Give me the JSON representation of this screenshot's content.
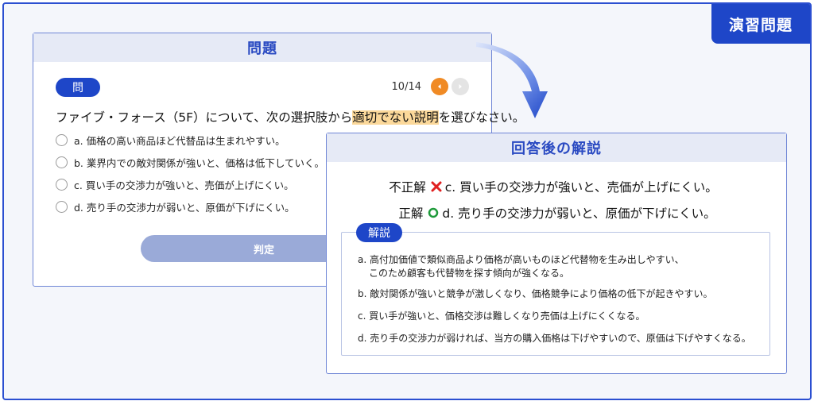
{
  "tag": "演習問題",
  "question_card": {
    "title": "問題",
    "badge": "問",
    "page_counter": "10/14",
    "question_before": "ファイブ・フォース（5F）について、次の選択肢から",
    "question_highlight": "適切でない説明",
    "question_after": "を選びなさい。",
    "options": [
      "a. 価格の高い商品ほど代替品は生まれやすい。",
      "b. 業界内での敵対関係が強いと、価格は低下していく。",
      "c. 買い手の交渉力が強いと、売価が上げにくい。",
      "d. 売り手の交渉力が弱いと、原価が下げにくい。"
    ],
    "judge_button": "判定"
  },
  "explanation_card": {
    "title": "回答後の解説",
    "incorrect_label": "不正解",
    "incorrect_answer": "c. 買い手の交渉力が強いと、売価が上げにくい。",
    "correct_label": "正解",
    "correct_answer": "d. 売り手の交渉力が弱いと、原価が下げにくい。",
    "explanation_badge": "解説",
    "explanations": {
      "a_line1": "a. 高付加価値で類似商品より価格が高いものほど代替物を生み出しやすい、",
      "a_line2": "このため顧客も代替物を探す傾向が強くなる。",
      "b": "b. 敵対関係が強いと競争が激しくなり、価格競争により価格の低下が起きやすい。",
      "c": "c. 買い手が強いと、価格交渉は難しくなり売価は上げにくくなる。",
      "d": "d. 売り手の交渉力が弱ければ、当方の購入価格は下げやすいので、原価は下げやすくなる。"
    }
  },
  "colors": {
    "primary": "#1e46c8",
    "highlight": "#fbd89a",
    "prev_button": "#f08a24",
    "incorrect_mark": "#e02020",
    "correct_mark": "#1e9a3a"
  },
  "icons": {
    "prev": "chevron-left-icon",
    "next": "chevron-right-icon",
    "incorrect": "cross-icon",
    "correct": "circle-icon",
    "arrow": "curved-arrow-down-icon"
  }
}
